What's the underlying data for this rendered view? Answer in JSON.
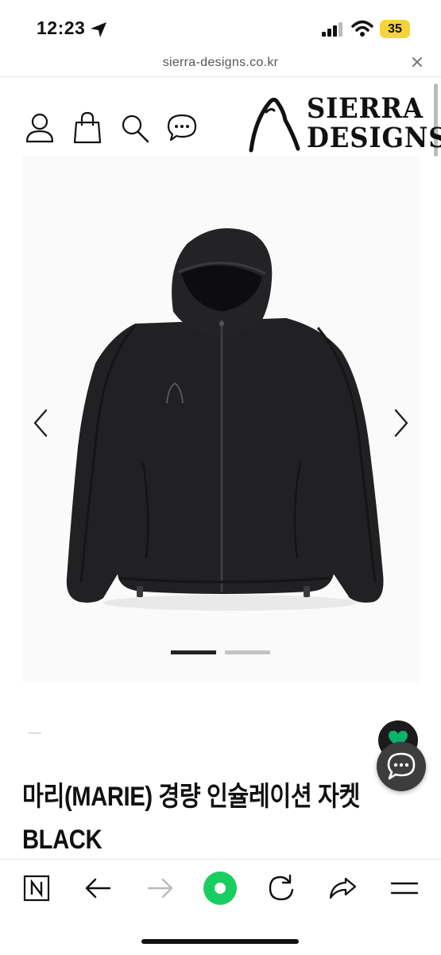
{
  "status_bar": {
    "time": "12:23",
    "battery": "35",
    "battery_color": "#f5d33a"
  },
  "browser": {
    "url": "sierra-designs.co.kr",
    "close_icon": "close-icon"
  },
  "header": {
    "icons": [
      "user-icon",
      "shopping-bag-icon",
      "search-icon",
      "chat-bubble-icon"
    ],
    "logo_line1": "SIERRA",
    "logo_line2": "DESIGNS"
  },
  "product": {
    "image_desc_icon": "black-hooded-jacket-image",
    "carousel_total": 2,
    "carousel_active": 1,
    "title_line1": "마리(MARIE) 경량 인슐레이션 자켓",
    "title_line2": "BLACK"
  },
  "floating": {
    "wishlist_icon": "heart-icon",
    "wishlist_color": "#0ab36b",
    "chat_icon": "chat-icon"
  },
  "toolbar": {
    "items": [
      "naver-n-icon",
      "back-arrow-icon",
      "forward-arrow-icon",
      "home-green-icon",
      "refresh-icon",
      "share-icon",
      "menu-icon"
    ],
    "accent": "#19ce60"
  }
}
